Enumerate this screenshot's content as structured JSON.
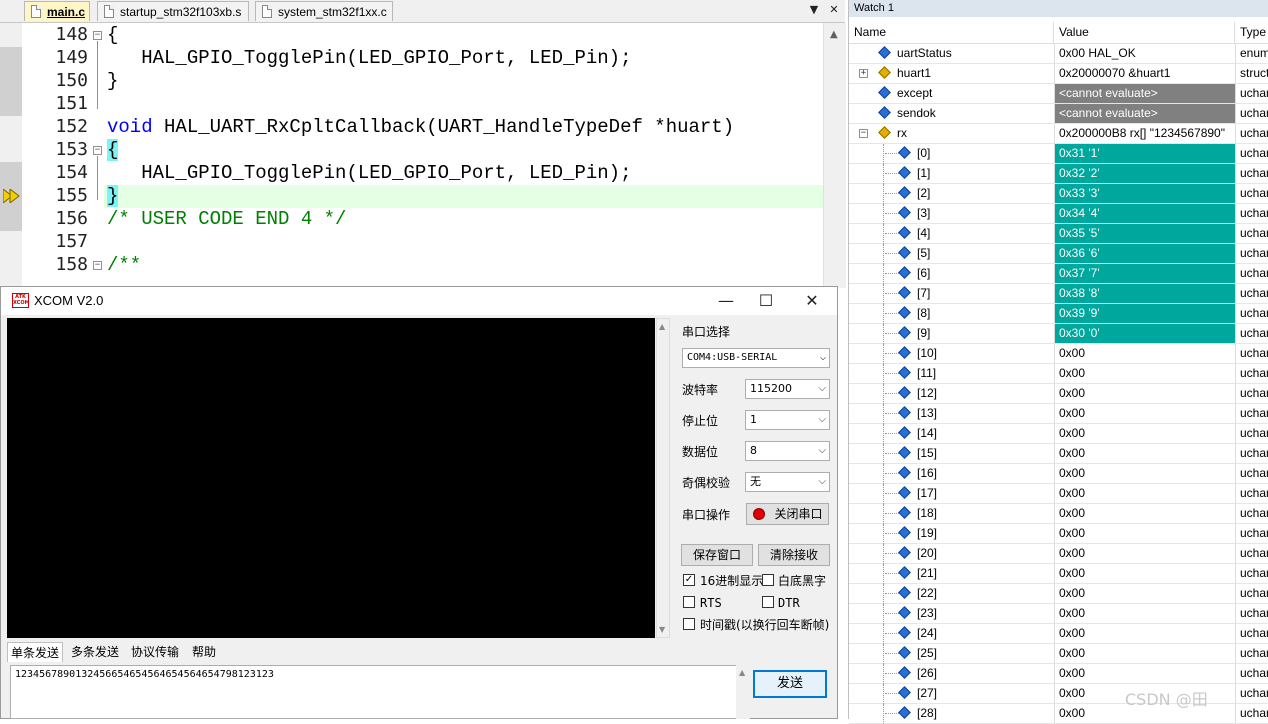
{
  "editor": {
    "tabs": [
      {
        "label": "main.c",
        "active": true
      },
      {
        "label": "startup_stm32f103xb.s",
        "active": false
      },
      {
        "label": "system_stm32f1xx.c",
        "active": false
      }
    ],
    "lines": [
      {
        "num": "148",
        "text": "{"
      },
      {
        "num": "149",
        "text": "   HAL_GPIO_TogglePin(LED_GPIO_Port, LED_Pin);"
      },
      {
        "num": "150",
        "text": "}"
      },
      {
        "num": "151",
        "text": ""
      },
      {
        "num": "152",
        "kw": "void",
        "text": " HAL_UART_RxCpltCallback(UART_HandleTypeDef *huart)"
      },
      {
        "num": "153",
        "text": "{"
      },
      {
        "num": "154",
        "text": "   HAL_GPIO_TogglePin(LED_GPIO_Port, LED_Pin);"
      },
      {
        "num": "155",
        "text": "}"
      },
      {
        "num": "156",
        "text": "/* USER CODE END 4 */"
      },
      {
        "num": "157",
        "text": ""
      },
      {
        "num": "158",
        "text": "/**"
      }
    ]
  },
  "xcom": {
    "title": "XCOM V2.0",
    "logo_text": "ATK XCOM",
    "labels": {
      "port": "串口选择",
      "baud": "波特率",
      "stop": "停止位",
      "data": "数据位",
      "parity": "奇偶校验",
      "op": "串口操作"
    },
    "values": {
      "port": "COM4:USB-SERIAL",
      "baud": "115200",
      "stop": "1",
      "data": "8",
      "parity": "无"
    },
    "buttons": {
      "close_port": "关闭串口",
      "save_window": "保存窗口",
      "clear_recv": "清除接收",
      "send": "发送"
    },
    "checks": {
      "hex_display": "16进制显示",
      "white_black": "白底黑字",
      "rts": "RTS",
      "dtr": "DTR",
      "timestamp": "时间戳(以换行回车断帧)"
    },
    "tabs": [
      "单条发送",
      "多条发送",
      "协议传输",
      "帮助"
    ],
    "send_text": "12345678901324566546545646545646547981231​23"
  },
  "watch": {
    "title": "Watch 1",
    "headers": {
      "name": "Name",
      "value": "Value",
      "type": "Type"
    },
    "rows": [
      {
        "name": "uartStatus",
        "value": "0x00 HAL_OK",
        "type": "enum",
        "style": "",
        "level": 0,
        "icon": "var",
        "exp": ""
      },
      {
        "name": "huart1",
        "value": "0x20000070 &huart1",
        "type": "struct",
        "style": "",
        "level": 0,
        "icon": "struct",
        "exp": "+"
      },
      {
        "name": "except",
        "value": "<cannot evaluate>",
        "type": "uchar",
        "style": "grey",
        "level": 0,
        "icon": "var",
        "exp": ""
      },
      {
        "name": "sendok",
        "value": "<cannot evaluate>",
        "type": "uchar",
        "style": "grey",
        "level": 0,
        "icon": "var",
        "exp": ""
      },
      {
        "name": "rx",
        "value": "0x200000B8 rx[] \"1234567890\"",
        "type": "uchar",
        "style": "",
        "level": 0,
        "icon": "struct",
        "exp": "-"
      },
      {
        "name": "[0]",
        "value": "0x31 '1'",
        "type": "uchar",
        "style": "teal",
        "level": 1,
        "icon": "var",
        "exp": ""
      },
      {
        "name": "[1]",
        "value": "0x32 '2'",
        "type": "uchar",
        "style": "teal",
        "level": 1,
        "icon": "var",
        "exp": ""
      },
      {
        "name": "[2]",
        "value": "0x33 '3'",
        "type": "uchar",
        "style": "teal",
        "level": 1,
        "icon": "var",
        "exp": ""
      },
      {
        "name": "[3]",
        "value": "0x34 '4'",
        "type": "uchar",
        "style": "teal",
        "level": 1,
        "icon": "var",
        "exp": ""
      },
      {
        "name": "[4]",
        "value": "0x35 '5'",
        "type": "uchar",
        "style": "teal",
        "level": 1,
        "icon": "var",
        "exp": ""
      },
      {
        "name": "[5]",
        "value": "0x36 '6'",
        "type": "uchar",
        "style": "teal",
        "level": 1,
        "icon": "var",
        "exp": ""
      },
      {
        "name": "[6]",
        "value": "0x37 '7'",
        "type": "uchar",
        "style": "teal",
        "level": 1,
        "icon": "var",
        "exp": ""
      },
      {
        "name": "[7]",
        "value": "0x38 '8'",
        "type": "uchar",
        "style": "teal",
        "level": 1,
        "icon": "var",
        "exp": ""
      },
      {
        "name": "[8]",
        "value": "0x39 '9'",
        "type": "uchar",
        "style": "teal",
        "level": 1,
        "icon": "var",
        "exp": ""
      },
      {
        "name": "[9]",
        "value": "0x30 '0'",
        "type": "uchar",
        "style": "teal",
        "level": 1,
        "icon": "var",
        "exp": ""
      },
      {
        "name": "[10]",
        "value": "0x00",
        "type": "uchar",
        "style": "",
        "level": 1,
        "icon": "var",
        "exp": ""
      },
      {
        "name": "[11]",
        "value": "0x00",
        "type": "uchar",
        "style": "",
        "level": 1,
        "icon": "var",
        "exp": ""
      },
      {
        "name": "[12]",
        "value": "0x00",
        "type": "uchar",
        "style": "",
        "level": 1,
        "icon": "var",
        "exp": ""
      },
      {
        "name": "[13]",
        "value": "0x00",
        "type": "uchar",
        "style": "",
        "level": 1,
        "icon": "var",
        "exp": ""
      },
      {
        "name": "[14]",
        "value": "0x00",
        "type": "uchar",
        "style": "",
        "level": 1,
        "icon": "var",
        "exp": ""
      },
      {
        "name": "[15]",
        "value": "0x00",
        "type": "uchar",
        "style": "",
        "level": 1,
        "icon": "var",
        "exp": ""
      },
      {
        "name": "[16]",
        "value": "0x00",
        "type": "uchar",
        "style": "",
        "level": 1,
        "icon": "var",
        "exp": ""
      },
      {
        "name": "[17]",
        "value": "0x00",
        "type": "uchar",
        "style": "",
        "level": 1,
        "icon": "var",
        "exp": ""
      },
      {
        "name": "[18]",
        "value": "0x00",
        "type": "uchar",
        "style": "",
        "level": 1,
        "icon": "var",
        "exp": ""
      },
      {
        "name": "[19]",
        "value": "0x00",
        "type": "uchar",
        "style": "",
        "level": 1,
        "icon": "var",
        "exp": ""
      },
      {
        "name": "[20]",
        "value": "0x00",
        "type": "uchar",
        "style": "",
        "level": 1,
        "icon": "var",
        "exp": ""
      },
      {
        "name": "[21]",
        "value": "0x00",
        "type": "uchar",
        "style": "",
        "level": 1,
        "icon": "var",
        "exp": ""
      },
      {
        "name": "[22]",
        "value": "0x00",
        "type": "uchar",
        "style": "",
        "level": 1,
        "icon": "var",
        "exp": ""
      },
      {
        "name": "[23]",
        "value": "0x00",
        "type": "uchar",
        "style": "",
        "level": 1,
        "icon": "var",
        "exp": ""
      },
      {
        "name": "[24]",
        "value": "0x00",
        "type": "uchar",
        "style": "",
        "level": 1,
        "icon": "var",
        "exp": ""
      },
      {
        "name": "[25]",
        "value": "0x00",
        "type": "uchar",
        "style": "",
        "level": 1,
        "icon": "var",
        "exp": ""
      },
      {
        "name": "[26]",
        "value": "0x00",
        "type": "uchar",
        "style": "",
        "level": 1,
        "icon": "var",
        "exp": ""
      },
      {
        "name": "[27]",
        "value": "0x00",
        "type": "uchar",
        "style": "",
        "level": 1,
        "icon": "var",
        "exp": ""
      },
      {
        "name": "[28]",
        "value": "0x00",
        "type": "uchar",
        "style": "",
        "level": 1,
        "icon": "var",
        "exp": ""
      }
    ]
  },
  "watermark": "CSDN @田"
}
